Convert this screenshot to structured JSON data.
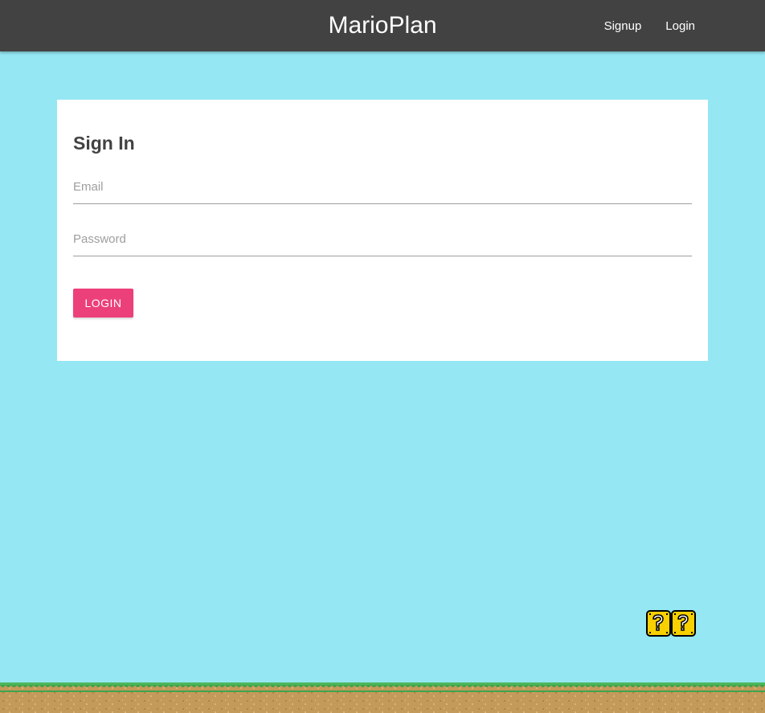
{
  "navbar": {
    "brand": "MarioPlan",
    "links": [
      {
        "label": "Signup"
      },
      {
        "label": "Login"
      }
    ]
  },
  "signin": {
    "title": "Sign In",
    "email_placeholder": "Email",
    "password_placeholder": "Password",
    "email_value": "",
    "password_value": "",
    "submit_label": "LOGIN"
  },
  "colors": {
    "navbar_bg": "#424242",
    "page_bg": "#94e7f3",
    "accent": "#ec407a"
  },
  "decorations": {
    "question_block_icon": "question-block-icon",
    "ground_icon": "grass-ground-icon"
  }
}
